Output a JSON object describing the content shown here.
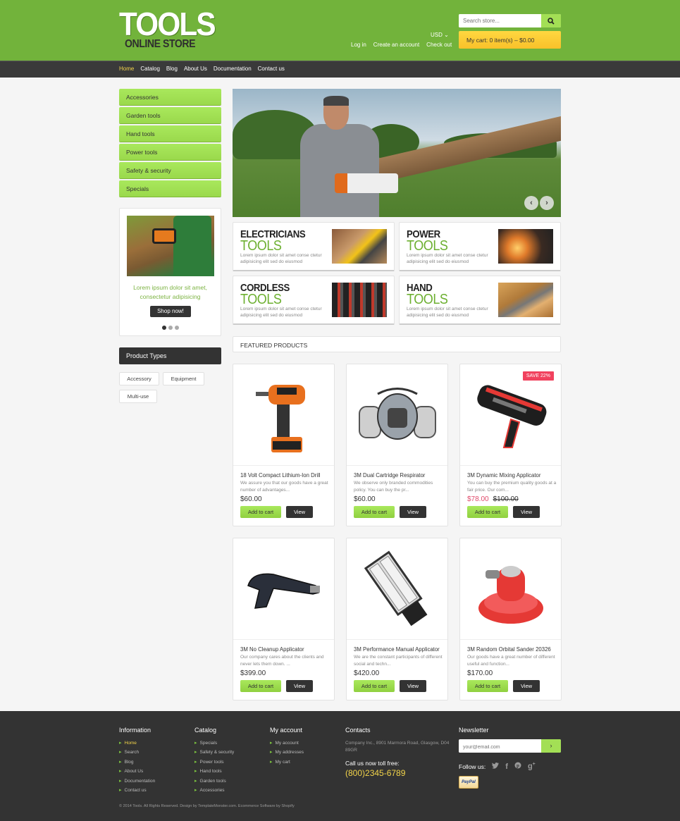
{
  "header": {
    "logo_main": "TOOLS",
    "logo_sub": "ONLINE STORE",
    "search_placeholder": "Search store...",
    "currency": "USD ⌄",
    "links": [
      "Log in",
      "Create an account",
      "Check out"
    ],
    "cart": "My cart: 0 item(s) – $0.00"
  },
  "nav": {
    "items": [
      "Home",
      "Catalog",
      "Blog",
      "About Us",
      "Documentation",
      "Contact us"
    ],
    "active": "Home"
  },
  "sidebar": {
    "categories": [
      "Accessories",
      "Garden tools",
      "Hand tools",
      "Power tools",
      "Safety & security",
      "Specials"
    ],
    "promo": {
      "text": "Lorem ipsum dolor sit amet, consectetur adipisicing",
      "button": "Shop now!",
      "slides": 3,
      "active_slide": 1
    },
    "product_types_title": "Product Types",
    "product_types": [
      "Accessory",
      "Equipment",
      "Multi-use"
    ]
  },
  "slider": {
    "prev": "‹",
    "next": "›"
  },
  "banners": [
    {
      "title": "ELECTRICIANS",
      "subtitle": "TOOLS",
      "desc": "Lorem ipsum dolor sit amet conse ctetur adipisicing elit sed do eiusmod"
    },
    {
      "title": "POWER",
      "subtitle": "TOOLS",
      "desc": "Lorem ipsum dolor sit amet conse ctetur adipisicing elit sed do eiusmod"
    },
    {
      "title": "CORDLESS",
      "subtitle": "TOOLS",
      "desc": "Lorem ipsum dolor sit amet conse ctetur adipisicing elit sed do eiusmod"
    },
    {
      "title": "HAND",
      "subtitle": "TOOLS",
      "desc": "Lorem ipsum dolor sit amet conse ctetur adipisicing elit sed do eiusmod"
    }
  ],
  "featured": {
    "title": "FEATURED PRODUCTS",
    "add_label": "Add to cart",
    "view_label": "View",
    "products": [
      {
        "name": "18 Volt Compact Lithium-Ion Drill",
        "desc": "We assure you that our goods have a great number of advantages...",
        "price": "$60.00"
      },
      {
        "name": "3M Dual Cartridge Respirator",
        "desc": "We observe only branded commodities policy. You can buy the pr...",
        "price": "$60.00"
      },
      {
        "name": "3M Dynamic Mixing Applicator",
        "desc": "You can buy the premium quality goods at a fair price. Our com...",
        "price": "$78.00",
        "old_price": "$100.00",
        "badge": "SAVE 22%"
      },
      {
        "name": "3M No Cleanup Applicator",
        "desc": "Our company cares about the clients and never lets them down. ...",
        "price": "$399.00"
      },
      {
        "name": "3M Performance Manual Applicator",
        "desc": "We are the constant participants of different social and techn...",
        "price": "$420.00"
      },
      {
        "name": "3M Random Orbital Sander 20326",
        "desc": "Our goods have a great number of different useful and function...",
        "price": "$170.00"
      }
    ]
  },
  "footer": {
    "information": {
      "title": "Information",
      "items": [
        "Home",
        "Search",
        "Blog",
        "About Us",
        "Documentation",
        "Contact us"
      ]
    },
    "catalog": {
      "title": "Catalog",
      "items": [
        "Specials",
        "Safety & security",
        "Power tools",
        "Hand tools",
        "Garden tools",
        "Accessories"
      ]
    },
    "account": {
      "title": "My account",
      "items": [
        "My account",
        "My addresses",
        "My cart"
      ]
    },
    "contacts": {
      "title": "Contacts",
      "address": "Company Inc., 8901 Marmora Road, Glasgow, D04 89GR",
      "call_label": "Call us now toll free:",
      "phone": "(800)2345-6789"
    },
    "newsletter": {
      "title": "Newsletter",
      "placeholder": "your@email.com",
      "button": "›"
    },
    "follow_label": "Follow us:",
    "paypal": "PayPal",
    "copyright": "© 2014 Tools. All Rights Reserved. Design by TemplateMonster.com. Ecommerce Software by Shopify"
  }
}
